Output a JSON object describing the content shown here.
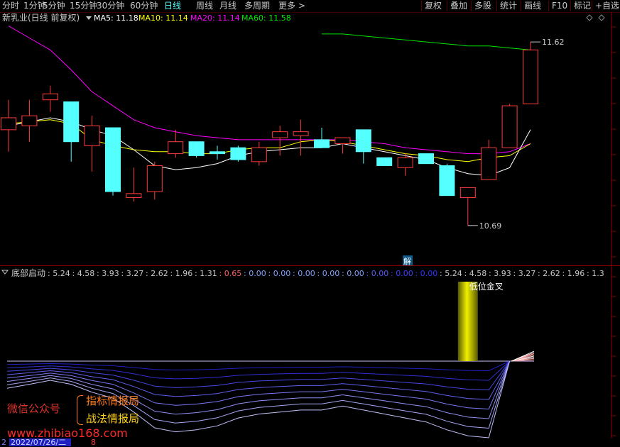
{
  "toolbar": {
    "left": [
      "分时",
      "1分钟",
      "5分钟",
      "15分钟",
      "30分钟",
      "60分钟",
      "日线",
      "周线",
      "月线",
      "多周期",
      "更多 >"
    ],
    "right": [
      "复权",
      "叠加",
      "多股",
      "统计",
      "画线",
      "F10",
      "标记",
      "+自选"
    ],
    "active": "日线"
  },
  "main_legend": {
    "stock": "新乳业(日线 前复权)",
    "items": [
      {
        "text": "MA5: 11.18",
        "color": "#ffffff"
      },
      {
        "text": "MA10: 11.14",
        "color": "#ffff00"
      },
      {
        "text": "MA20: 11.14",
        "color": "#ff00ff"
      },
      {
        "text": "MA60: 11.58",
        "color": "#00e600"
      }
    ]
  },
  "price_labels": {
    "high": "11.62",
    "low": "10.69",
    "marker": "解"
  },
  "indicator_legend": {
    "name": "底部启动",
    "values": [
      {
        "text": ": 5.24",
        "color": "#c8c8c8"
      },
      {
        "text": ": 4.58",
        "color": "#c8c8c8"
      },
      {
        "text": ": 3.93",
        "color": "#c8c8c8"
      },
      {
        "text": ": 3.27",
        "color": "#c8c8c8"
      },
      {
        "text": ": 2.62",
        "color": "#c8c8c8"
      },
      {
        "text": ": 1.96",
        "color": "#c8c8c8"
      },
      {
        "text": ": 1.31",
        "color": "#c8c8c8"
      },
      {
        "text": ": 0.65",
        "color": "#ff6060"
      },
      {
        "text": ": 0.00",
        "color": "#7fa0ff"
      },
      {
        "text": ": 0.00",
        "color": "#7fa0ff"
      },
      {
        "text": ": 0.00",
        "color": "#7fa0ff"
      },
      {
        "text": ": 0.00",
        "color": "#7fa0ff"
      },
      {
        "text": ": 0.00",
        "color": "#7fa0ff"
      },
      {
        "text": ": 0.00",
        "color": "#5a5aff"
      },
      {
        "text": ": 0.00",
        "color": "#4040ff"
      },
      {
        "text": ": 0.00",
        "color": "#3030ff"
      },
      {
        "text": ": 5.24",
        "color": "#c8c8c8"
      },
      {
        "text": ": 4.58",
        "color": "#c8c8c8"
      },
      {
        "text": ": 3.93",
        "color": "#c8c8c8"
      },
      {
        "text": ": 3.27",
        "color": "#c8c8c8"
      },
      {
        "text": ": 2.62",
        "color": "#c8c8c8"
      },
      {
        "text": ": 1.96",
        "color": "#c8c8c8"
      },
      {
        "text": ": 1.3",
        "color": "#c8c8c8"
      }
    ],
    "signal_label": "低位金叉"
  },
  "watermark": {
    "wechat": "微信公众号",
    "line1": "指标情报局",
    "line2": "战法情报局",
    "url": "www.zhibiao168.com"
  },
  "date_bar": {
    "prefix": "2",
    "date": "2022/07/26/二",
    "suffix": "8"
  },
  "colors": {
    "up": "#ff3c3c",
    "down": "#54ffff",
    "ma5": "#ffffff",
    "ma10": "#ffff00",
    "ma20": "#ff00ff",
    "ma60": "#00e600"
  },
  "chart_data": {
    "type": "candlestick",
    "ylim": [
      10.55,
      11.72
    ],
    "candles": [
      {
        "o": 11.18,
        "c": 11.24,
        "h": 11.33,
        "l": 11.07
      },
      {
        "o": 11.2,
        "c": 11.25,
        "h": 11.33,
        "l": 11.12
      },
      {
        "o": 11.33,
        "c": 11.36,
        "h": 11.4,
        "l": 11.27
      },
      {
        "o": 11.32,
        "c": 11.12,
        "h": 11.32,
        "l": 11.02
      },
      {
        "o": 11.1,
        "c": 11.2,
        "h": 11.25,
        "l": 10.97
      },
      {
        "o": 11.19,
        "c": 10.87,
        "h": 11.19,
        "l": 10.85
      },
      {
        "o": 10.84,
        "c": 10.86,
        "h": 10.99,
        "l": 10.82
      },
      {
        "o": 10.87,
        "c": 11.0,
        "h": 11.02,
        "l": 10.83
      },
      {
        "o": 11.06,
        "c": 11.12,
        "h": 11.18,
        "l": 11.04
      },
      {
        "o": 11.12,
        "c": 11.05,
        "h": 11.12,
        "l": 11.04
      },
      {
        "o": 11.07,
        "c": 11.06,
        "h": 11.1,
        "l": 11.03
      },
      {
        "o": 11.09,
        "c": 11.03,
        "h": 11.1,
        "l": 11.02
      },
      {
        "o": 11.02,
        "c": 11.09,
        "h": 11.12,
        "l": 11.0
      },
      {
        "o": 11.14,
        "c": 11.17,
        "h": 11.2,
        "l": 11.05
      },
      {
        "o": 11.15,
        "c": 11.17,
        "h": 11.23,
        "l": 11.05
      },
      {
        "o": 11.13,
        "c": 11.09,
        "h": 11.19,
        "l": 11.09
      },
      {
        "o": 11.11,
        "c": 11.14,
        "h": 11.14,
        "l": 11.06
      },
      {
        "o": 11.18,
        "c": 11.07,
        "h": 11.18,
        "l": 11.01
      },
      {
        "o": 11.04,
        "c": 11.0,
        "h": 11.04,
        "l": 11.0
      },
      {
        "o": 10.99,
        "c": 11.04,
        "h": 11.06,
        "l": 10.95
      },
      {
        "o": 11.06,
        "c": 11.01,
        "h": 11.06,
        "l": 11.01
      },
      {
        "o": 11.0,
        "c": 10.85,
        "h": 11.01,
        "l": 10.85
      },
      {
        "o": 10.84,
        "c": 10.89,
        "h": 10.89,
        "l": 10.7
      },
      {
        "o": 10.93,
        "c": 11.09,
        "h": 11.13,
        "l": 10.93
      },
      {
        "o": 11.09,
        "c": 11.3,
        "h": 11.31,
        "l": 11.15
      },
      {
        "o": 11.31,
        "c": 11.58,
        "h": 11.62,
        "l": 11.37
      }
    ],
    "ma5": [
      11.2,
      11.22,
      11.24,
      11.22,
      11.18,
      11.15,
      11.08,
      11.0,
      10.98,
      10.99,
      11.01,
      11.05,
      11.07,
      11.08,
      11.09,
      11.09,
      11.11,
      11.09,
      11.07,
      11.05,
      11.03,
      10.99,
      10.96,
      10.95,
      10.99,
      11.18
    ],
    "ma10": [
      11.21,
      11.22,
      11.23,
      11.21,
      11.13,
      11.1,
      11.08,
      11.07,
      11.07,
      11.06,
      11.06,
      11.08,
      11.09,
      11.09,
      11.12,
      11.13,
      11.12,
      11.1,
      11.08,
      11.06,
      11.05,
      11.03,
      11.02,
      11.04,
      11.05,
      11.11
    ],
    "ma20": [
      11.7,
      11.64,
      11.58,
      11.48,
      11.37,
      11.3,
      11.23,
      11.19,
      11.17,
      11.15,
      11.14,
      11.13,
      11.13,
      11.13,
      11.13,
      11.13,
      11.13,
      11.12,
      11.11,
      11.09,
      11.08,
      11.07,
      11.06,
      11.06,
      11.07,
      11.11
    ],
    "ma60": [
      null,
      null,
      null,
      null,
      null,
      null,
      null,
      null,
      null,
      null,
      null,
      null,
      null,
      null,
      null,
      11.66,
      11.66,
      11.65,
      11.64,
      11.63,
      11.62,
      11.61,
      11.6,
      11.6,
      11.59,
      11.58
    ],
    "indicator": {
      "name": "底部启动",
      "levels": [
        5.24,
        4.58,
        3.93,
        3.27,
        2.62,
        1.96,
        1.31,
        0.65
      ],
      "signal_index": 22,
      "signal_label": "低位金叉"
    }
  }
}
